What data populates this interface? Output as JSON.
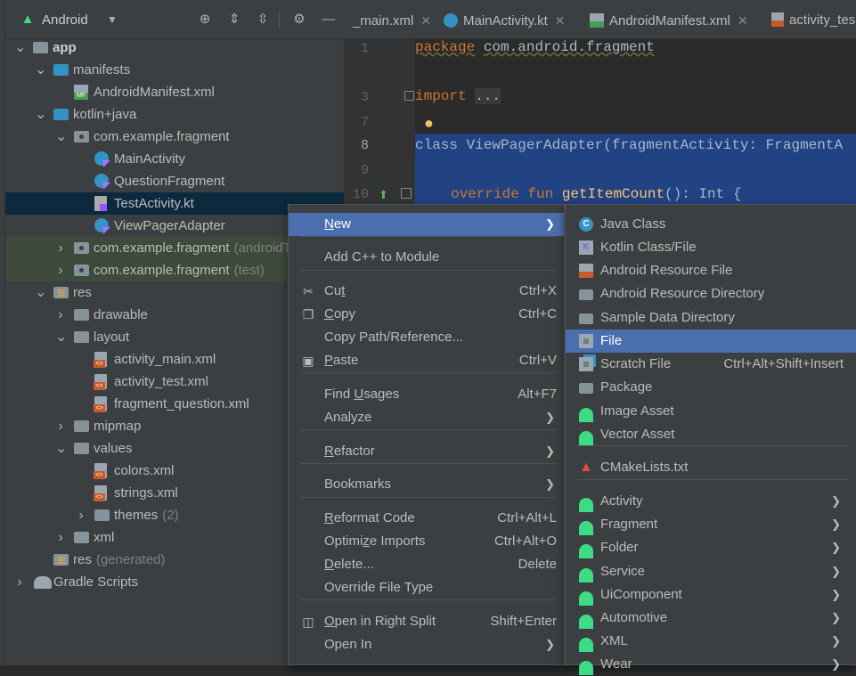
{
  "project_view": {
    "selector": "Android",
    "tree": [
      {
        "label": "app",
        "bold": true,
        "indent": 0,
        "arrow": "down",
        "icon": "module-folder-icon"
      },
      {
        "label": "manifests",
        "indent": 1,
        "arrow": "down",
        "icon": "manifest-folder-icon"
      },
      {
        "label": "AndroidManifest.xml",
        "indent": 2,
        "icon": "manifest-file-icon"
      },
      {
        "label": "kotlin+java",
        "indent": 1,
        "arrow": "down",
        "icon": "source-folder-icon"
      },
      {
        "label": "com.example.fragment",
        "indent": 2,
        "arrow": "down",
        "icon": "package-icon"
      },
      {
        "label": "MainActivity",
        "indent": 3,
        "icon": "kotlin-class-icon"
      },
      {
        "label": "QuestionFragment",
        "indent": 3,
        "icon": "kotlin-class-icon"
      },
      {
        "label": "TestActivity.kt",
        "indent": 3,
        "icon": "kotlin-file-icon",
        "selected": true
      },
      {
        "label": "ViewPagerAdapter",
        "indent": 3,
        "icon": "kotlin-class-icon"
      },
      {
        "label": "com.example.fragment",
        "suffix": "(androidT",
        "indent": 2,
        "arrow": "right",
        "icon": "package-icon",
        "green": true
      },
      {
        "label": "com.example.fragment",
        "suffix": "(test)",
        "indent": 2,
        "arrow": "right",
        "icon": "package-icon",
        "green": true
      },
      {
        "label": "res",
        "indent": 1,
        "arrow": "down",
        "icon": "res-folder-icon"
      },
      {
        "label": "drawable",
        "indent": 2,
        "arrow": "right",
        "icon": "folder-icon"
      },
      {
        "label": "layout",
        "indent": 2,
        "arrow": "down",
        "icon": "folder-icon"
      },
      {
        "label": "activity_main.xml",
        "indent": 3,
        "icon": "layout-xml-icon"
      },
      {
        "label": "activity_test.xml",
        "indent": 3,
        "icon": "layout-xml-icon"
      },
      {
        "label": "fragment_question.xml",
        "indent": 3,
        "icon": "layout-xml-icon"
      },
      {
        "label": "mipmap",
        "indent": 2,
        "arrow": "right",
        "icon": "folder-icon"
      },
      {
        "label": "values",
        "indent": 2,
        "arrow": "down",
        "icon": "folder-icon"
      },
      {
        "label": "colors.xml",
        "indent": 3,
        "icon": "values-xml-icon"
      },
      {
        "label": "strings.xml",
        "indent": 3,
        "icon": "values-xml-icon"
      },
      {
        "label": "themes",
        "suffix": "(2)",
        "indent": 3,
        "arrow": "right",
        "icon": "folder-icon"
      },
      {
        "label": "xml",
        "indent": 2,
        "arrow": "right",
        "icon": "folder-icon"
      },
      {
        "label": "res",
        "suffix": "(generated)",
        "indent": 1,
        "icon": "res-folder-icon"
      },
      {
        "label": "Gradle Scripts",
        "indent": 0,
        "arrow": "right",
        "icon": "gradle-icon"
      }
    ]
  },
  "editor": {
    "tabs": [
      {
        "label": "_main.xml",
        "icon": "layout-xml-icon"
      },
      {
        "label": "MainActivity.kt",
        "icon": "kotlin-class-icon"
      },
      {
        "label": "AndroidManifest.xml",
        "icon": "manifest-file-icon"
      },
      {
        "label": "activity_tes",
        "icon": "layout-xml-icon"
      }
    ],
    "line_numbers": [
      "1",
      "3",
      "7",
      "8",
      "9",
      "10"
    ],
    "code": {
      "l1_kw": "package",
      "l1_rest": "com.android.fragment",
      "l3_kw": "import",
      "l3_rest": "...",
      "l8": "class ViewPagerAdapter(fragmentActivity: FragmentA",
      "l10_kw": "override fun",
      "l10_fn": "getItemCount",
      "l10_rest": "(): Int {"
    }
  },
  "context_menu": {
    "items": [
      {
        "label": "New",
        "submenu": true,
        "highlighted": true
      },
      {
        "label": "Add C++ to Module"
      },
      {
        "label": "Cut",
        "shortcut": "Ctrl+X",
        "icon": "cut-icon"
      },
      {
        "label": "Copy",
        "shortcut": "Ctrl+C",
        "icon": "copy-icon"
      },
      {
        "label": "Copy Path/Reference..."
      },
      {
        "label": "Paste",
        "shortcut": "Ctrl+V",
        "icon": "paste-icon"
      },
      {
        "label": "Find Usages",
        "shortcut": "Alt+F7"
      },
      {
        "label": "Analyze",
        "submenu": true
      },
      {
        "label": "Refactor",
        "submenu": true
      },
      {
        "label": "Bookmarks",
        "submenu": true
      },
      {
        "label": "Reformat Code",
        "shortcut": "Ctrl+Alt+L"
      },
      {
        "label": "Optimize Imports",
        "shortcut": "Ctrl+Alt+O"
      },
      {
        "label": "Delete...",
        "shortcut": "Delete"
      },
      {
        "label": "Override File Type"
      },
      {
        "label": "Open in Right Split",
        "shortcut": "Shift+Enter",
        "icon": "split-icon"
      },
      {
        "label": "Open In",
        "submenu": true
      }
    ]
  },
  "new_submenu": {
    "items": [
      {
        "label": "Java Class",
        "icon": "java-class-icon"
      },
      {
        "label": "Kotlin Class/File",
        "icon": "kotlin-file-icon"
      },
      {
        "label": "Android Resource File",
        "icon": "resource-file-icon"
      },
      {
        "label": "Android Resource Directory",
        "icon": "folder-icon"
      },
      {
        "label": "Sample Data Directory",
        "icon": "folder-icon"
      },
      {
        "label": "File",
        "icon": "file-icon",
        "highlighted": true
      },
      {
        "label": "Scratch File",
        "shortcut": "Ctrl+Alt+Shift+Insert",
        "icon": "scratch-file-icon"
      },
      {
        "label": "Package",
        "icon": "package-icon"
      },
      {
        "label": "Image Asset",
        "icon": "android-icon"
      },
      {
        "label": "Vector Asset",
        "icon": "android-icon"
      },
      {
        "label": "CMakeLists.txt",
        "icon": "cmake-icon"
      },
      {
        "label": "Activity",
        "submenu": true,
        "icon": "android-icon"
      },
      {
        "label": "Fragment",
        "submenu": true,
        "icon": "android-icon"
      },
      {
        "label": "Folder",
        "submenu": true,
        "icon": "android-icon"
      },
      {
        "label": "Service",
        "submenu": true,
        "icon": "android-icon"
      },
      {
        "label": "UiComponent",
        "submenu": true,
        "icon": "android-icon"
      },
      {
        "label": "Automotive",
        "submenu": true,
        "icon": "android-icon"
      },
      {
        "label": "XML",
        "submenu": true,
        "icon": "android-icon"
      },
      {
        "label": "Wear",
        "submenu": true,
        "icon": "android-icon"
      }
    ]
  },
  "colors": {
    "highlight": "#4b6eaf",
    "keyword": "#cc7832",
    "selection": "#214283",
    "tree_selection": "#0d293e",
    "android_green": "#3ddc84"
  }
}
